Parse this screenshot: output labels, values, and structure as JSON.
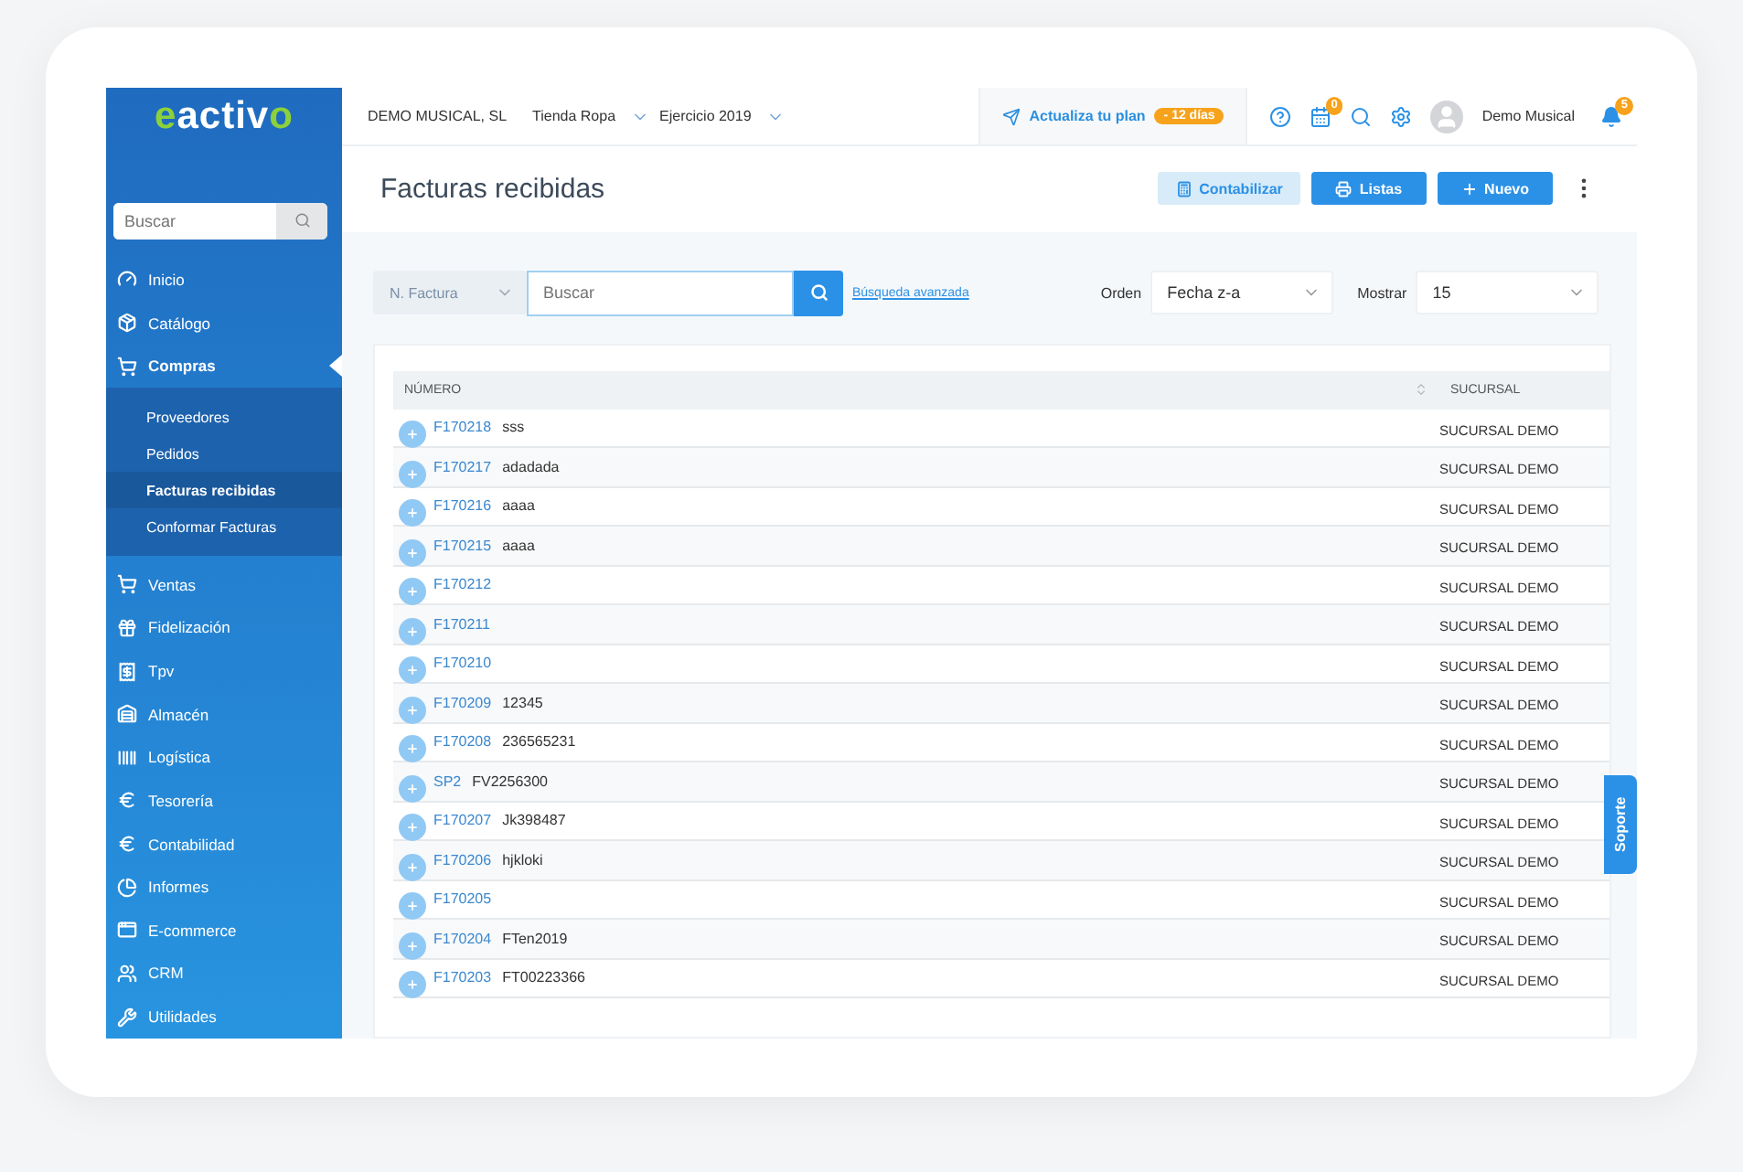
{
  "logo": {
    "prefix": "e",
    "rest": "activ",
    "accent": "o"
  },
  "sidebar": {
    "search": {
      "placeholder": "Buscar"
    },
    "items": [
      {
        "label": "Inicio",
        "selected": false
      },
      {
        "label": "Catálogo",
        "selected": false
      },
      {
        "label": "Compras",
        "selected": true,
        "expanded": true,
        "children": [
          {
            "label": "Proveedores",
            "selected": false
          },
          {
            "label": "Pedidos",
            "selected": false
          },
          {
            "label": "Facturas recibidas",
            "selected": true
          },
          {
            "label": "Conformar Facturas",
            "selected": false
          }
        ]
      },
      {
        "label": "Ventas",
        "selected": false
      },
      {
        "label": "Fidelización",
        "selected": false
      },
      {
        "label": "Tpv",
        "selected": false
      },
      {
        "label": "Almacén",
        "selected": false
      },
      {
        "label": "Logística",
        "selected": false
      },
      {
        "label": "Tesorería",
        "selected": false
      },
      {
        "label": "Contabilidad",
        "selected": false
      },
      {
        "label": "Informes",
        "selected": false
      },
      {
        "label": "E-commerce",
        "selected": false
      },
      {
        "label": "CRM",
        "selected": false
      },
      {
        "label": "Utilidades",
        "selected": false
      }
    ]
  },
  "topbar": {
    "company": "DEMO MUSICAL, SL",
    "store": "Tienda Ropa",
    "year": "Ejercicio 2019",
    "upgrade": "Actualiza tu plan",
    "trial_badge": "- 12 días",
    "calendar_badge": "0",
    "user": "Demo Musical",
    "notifications_badge": "5"
  },
  "header": {
    "title": "Facturas recibidas",
    "buttons": [
      {
        "label": "Contabilizar",
        "kind": "light"
      },
      {
        "label": "Listas",
        "kind": "primary"
      },
      {
        "label": "Nuevo",
        "kind": "primary"
      }
    ]
  },
  "filters": {
    "field": "N. Factura",
    "search": {
      "placeholder": "Buscar"
    },
    "advanced_link": "Búsqueda avanzada",
    "order_label": "Orden",
    "order": "Fecha z-a",
    "show_label": "Mostrar",
    "show": "15"
  },
  "table": {
    "columns": [
      "NÚMERO",
      "SUCURSAL"
    ],
    "rows": [
      {
        "number": "F170218",
        "description": "sss",
        "branch": "SUCURSAL DEMO"
      },
      {
        "number": "F170217",
        "description": "adadada",
        "branch": "SUCURSAL DEMO"
      },
      {
        "number": "F170216",
        "description": "aaaa",
        "branch": "SUCURSAL DEMO"
      },
      {
        "number": "F170215",
        "description": "aaaa",
        "branch": "SUCURSAL DEMO"
      },
      {
        "number": "F170212",
        "branch": "SUCURSAL DEMO"
      },
      {
        "number": "F170211",
        "branch": "SUCURSAL DEMO"
      },
      {
        "number": "F170210",
        "branch": "SUCURSAL DEMO"
      },
      {
        "number": "F170209",
        "description": "12345",
        "branch": "SUCURSAL DEMO"
      },
      {
        "number": "F170208",
        "description": "236565231",
        "branch": "SUCURSAL DEMO"
      },
      {
        "number": "SP2",
        "description": "FV2256300",
        "branch": "SUCURSAL DEMO"
      },
      {
        "number": "F170207",
        "description": "Jk398487",
        "branch": "SUCURSAL DEMO"
      },
      {
        "number": "F170206",
        "description": "hjkloki",
        "branch": "SUCURSAL DEMO"
      },
      {
        "number": "F170205",
        "branch": "SUCURSAL DEMO"
      },
      {
        "number": "F170204",
        "description": "FTen2019",
        "branch": "SUCURSAL DEMO"
      },
      {
        "number": "F170203",
        "description": "FT00223366",
        "branch": "SUCURSAL DEMO"
      }
    ]
  },
  "support_tab": "Soporte"
}
